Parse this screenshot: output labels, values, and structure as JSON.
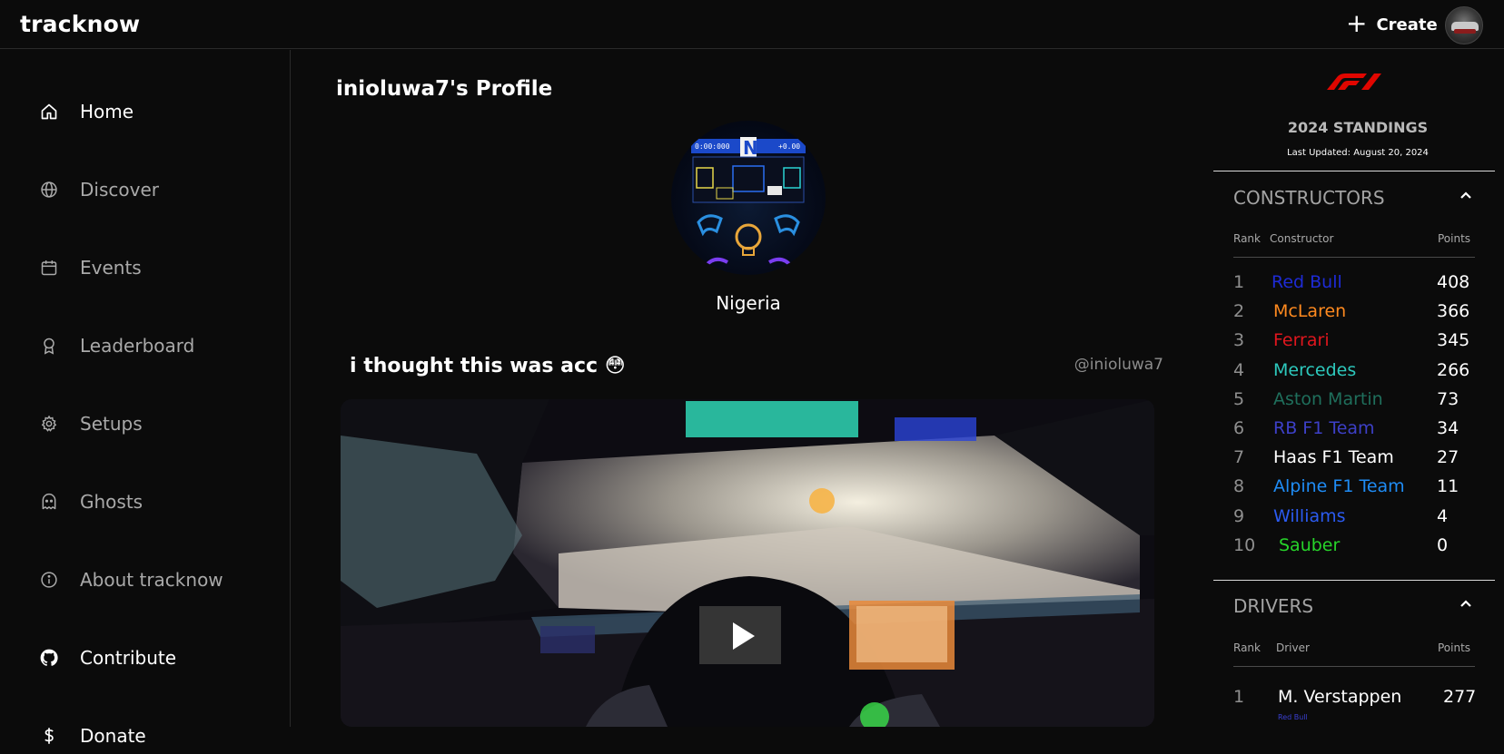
{
  "app": {
    "name": "tracknow"
  },
  "header": {
    "create_label": "Create",
    "avatar_alt": ""
  },
  "sidebar": {
    "items": [
      {
        "label": "Home",
        "icon": "home-icon"
      },
      {
        "label": "Discover",
        "icon": "globe-icon"
      },
      {
        "label": "Events",
        "icon": "calendar-icon"
      },
      {
        "label": "Leaderboard",
        "icon": "ribbon-icon"
      },
      {
        "label": "Setups",
        "icon": "gear-icon"
      },
      {
        "label": "Ghosts",
        "icon": "ghost-icon"
      },
      {
        "label": "About tracknow",
        "icon": "info-icon"
      },
      {
        "label": "Contribute",
        "icon": "github-icon"
      },
      {
        "label": "Donate",
        "icon": "dollar-icon"
      }
    ]
  },
  "profile": {
    "title": "inioluwa7's Profile",
    "country": "Nigeria"
  },
  "post": {
    "title": "i thought this was acc 😳",
    "username": "@inioluwa7"
  },
  "standings": {
    "title": "2024 STANDINGS",
    "updated": "Last Updated: August 20, 2024",
    "constructors": {
      "heading": "CONSTRUCTORS",
      "col_rank": "Rank",
      "col_name": "Constructor",
      "col_points": "Points",
      "rows": [
        {
          "rank": "1",
          "name": "Red Bull",
          "points": "408",
          "color": "#1e2bd6"
        },
        {
          "rank": "2",
          "name": "McLaren",
          "points": "366",
          "color": "#ff8a1f"
        },
        {
          "rank": "3",
          "name": "Ferrari",
          "points": "345",
          "color": "#e0161e"
        },
        {
          "rank": "4",
          "name": "Mercedes",
          "points": "266",
          "color": "#2dc9bd"
        },
        {
          "rank": "5",
          "name": "Aston Martin",
          "points": "73",
          "color": "#1f6f5c"
        },
        {
          "rank": "6",
          "name": "RB F1 Team",
          "points": "34",
          "color": "#3d40c8"
        },
        {
          "rank": "7",
          "name": "Haas F1 Team",
          "points": "27",
          "color": "#ffffff"
        },
        {
          "rank": "8",
          "name": "Alpine F1 Team",
          "points": "11",
          "color": "#1f8cf5"
        },
        {
          "rank": "9",
          "name": "Williams",
          "points": "4",
          "color": "#2b5bf0"
        },
        {
          "rank": "10",
          "name": "Sauber",
          "points": "0",
          "color": "#27d42a"
        }
      ]
    },
    "drivers": {
      "heading": "DRIVERS",
      "col_rank": "Rank",
      "col_name": "Driver",
      "col_points": "Points",
      "rows": [
        {
          "rank": "1",
          "name": "M. Verstappen",
          "team": "Red Bull",
          "points": "277"
        }
      ]
    }
  }
}
